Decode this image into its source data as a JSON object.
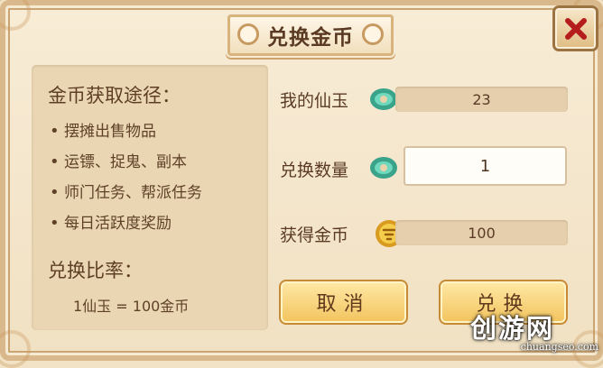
{
  "dialog": {
    "title": "兑换金币",
    "close_label": "✕"
  },
  "left_panel": {
    "route_title": "金币获取途径：",
    "routes": [
      "摆摊出售物品",
      "运镖、捉鬼、副本",
      "师门任务、帮派任务",
      "每日活跃度奖励"
    ],
    "rate_title": "兑换比率：",
    "rate_value": "1仙玉 = 100金币"
  },
  "fields": {
    "my_jade_label": "我的仙玉",
    "my_jade_value": "23",
    "exchange_qty_label": "兑换数量",
    "exchange_qty_value": "1",
    "gold_received_label": "获得金币",
    "gold_received_value": "100"
  },
  "buttons": {
    "cancel": "取消",
    "exchange": "兑换"
  },
  "watermark": {
    "main": "创游网",
    "sub": "chuangseo.com"
  },
  "icons": {
    "jade": "jade-icon",
    "gold": "gold-coin-icon",
    "close": "close-icon"
  },
  "colors": {
    "background": "#f3e3c6",
    "panel": "#ead6b3",
    "button": "#f2c35d",
    "close": "#b51d1d"
  }
}
